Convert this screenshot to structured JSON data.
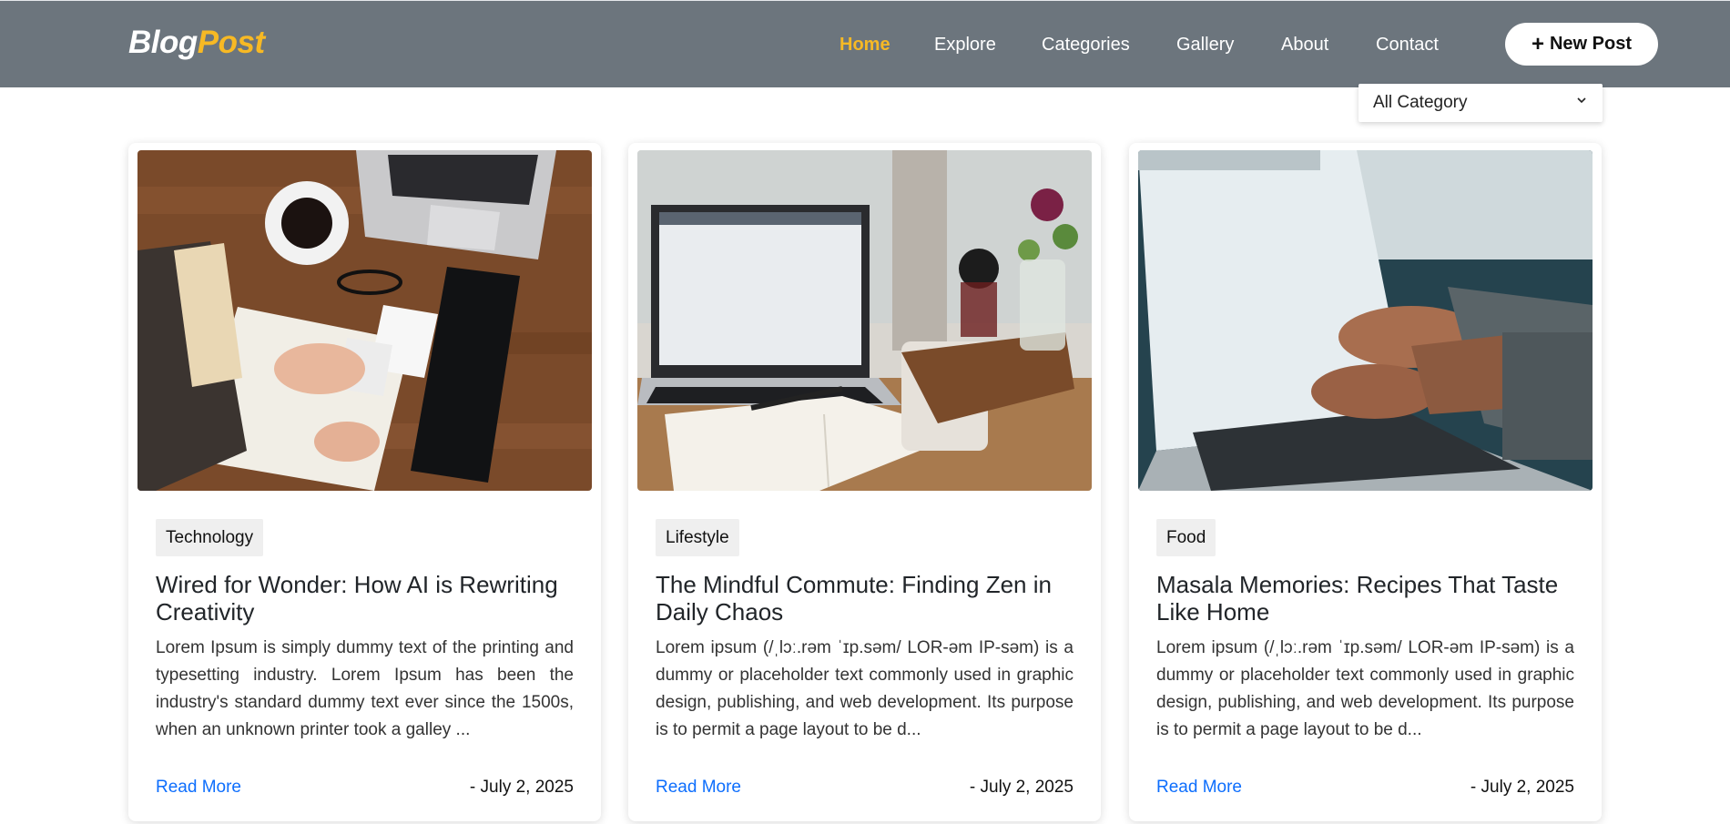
{
  "brand": {
    "part1": "Blog",
    "part2": "Post"
  },
  "nav": {
    "links": [
      {
        "label": "Home",
        "active": true
      },
      {
        "label": "Explore",
        "active": false
      },
      {
        "label": "Categories",
        "active": false
      },
      {
        "label": "Gallery",
        "active": false
      },
      {
        "label": "About",
        "active": false
      },
      {
        "label": "Contact",
        "active": false
      }
    ],
    "new_post": {
      "icon": "plus-icon",
      "label": "New Post"
    }
  },
  "filter": {
    "selected": "All Category",
    "icon": "chevron-down-icon"
  },
  "posts": [
    {
      "image": "desk-notebook-laptop-photo",
      "category": "Technology",
      "title": "Wired for Wonder: How AI is Rewriting Creativity",
      "excerpt": "Lorem Ipsum is simply dummy text of the printing and typesetting industry. Lorem Ipsum has been the industry's standard dummy text ever since the 1500s, when an unknown printer took a galley ...",
      "read_more": "Read More",
      "date": "- July 2, 2025"
    },
    {
      "image": "laptop-open-book-photo",
      "category": "Lifestyle",
      "title": "The Mindful Commute: Finding Zen in Daily Chaos",
      "excerpt": "Lorem ipsum (/ˌlɔː.rəm ˈɪp.səm/ LOR-əm IP-səm) is a dummy or placeholder text commonly used in graphic design, publishing, and web development. Its purpose is to permit a page layout to be d...",
      "read_more": "Read More",
      "date": "- July 2, 2025"
    },
    {
      "image": "typing-laptop-photo",
      "category": "Food",
      "title": "Masala Memories: Recipes That Taste Like Home",
      "excerpt": "Lorem ipsum (/ˌlɔː.rəm ˈɪp.səm/ LOR-əm IP-səm) is a dummy or placeholder text commonly used in graphic design, publishing, and web development. Its purpose is to permit a page layout to be d...",
      "read_more": "Read More",
      "date": "- July 2, 2025"
    }
  ],
  "colors": {
    "navbar": "#6c757d",
    "accent": "#f7b924",
    "link": "#0d6efd"
  }
}
